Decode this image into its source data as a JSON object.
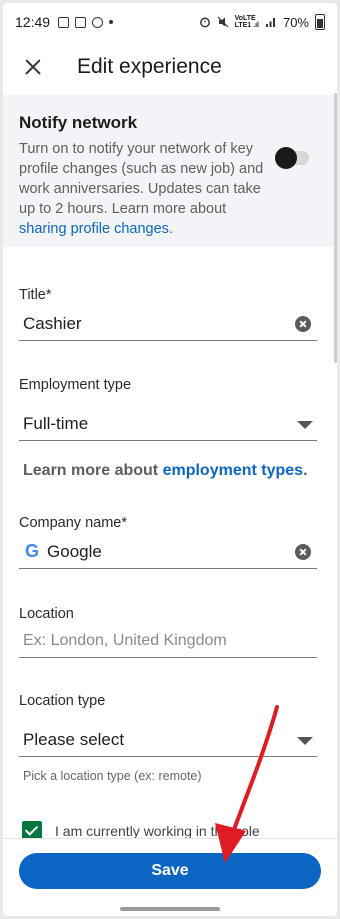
{
  "status_bar": {
    "time": "12:49",
    "battery": "70%",
    "volte_line1": "VoLTE",
    "volte_line2": "LTE1 .ıl"
  },
  "header": {
    "title": "Edit experience",
    "close_icon": "close-icon"
  },
  "notify": {
    "title": "Notify network",
    "text": "Turn on to notify your network of key profile changes (such as new job) and work anniversaries. Updates can take up to 2 hours. Learn more about ",
    "link": "sharing profile changes",
    "text_end": ".",
    "toggle_on": false
  },
  "form": {
    "title_label": "Title*",
    "title_value": "Cashier",
    "employment_label": "Employment type",
    "employment_value": "Full-time",
    "learn_prefix": "Learn more about ",
    "learn_link": "employment types",
    "learn_suffix": ".",
    "company_label": "Company name*",
    "company_value": "Google",
    "company_logo": "G",
    "location_label": "Location",
    "location_placeholder": "Ex: London, United Kingdom",
    "location_type_label": "Location type",
    "location_type_value": "Please select",
    "location_type_helper": "Pick a location type (ex: remote)",
    "current_role_label": "I am currently working in this role",
    "current_role_checked": true
  },
  "footer": {
    "save_label": "Save"
  },
  "colors": {
    "accent": "#0a66c2",
    "checkbox": "#057642",
    "annotation_arrow": "#e01b24"
  }
}
